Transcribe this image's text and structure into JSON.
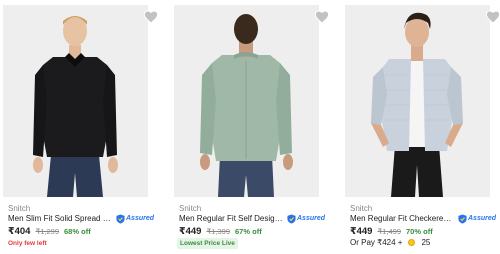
{
  "colors": {
    "image_bg": "#eeeeee",
    "offer_green": "#388e3c",
    "alert_red": "#e53935",
    "assured_blue": "#2874f0",
    "heart_grey": "#c2c2c2"
  },
  "products": [
    {
      "brand": "Snitch",
      "title": "Men Slim Fit Solid Spread Collar ...",
      "assured_label": "Assured",
      "price": "₹404",
      "mrp": "₹1,299",
      "discount": "68% off",
      "note": "Only few left",
      "shirt_color": "#1b1b1d",
      "pants_color": "#2c3a55",
      "icon": "heart-icon"
    },
    {
      "brand": "Snitch",
      "title": "Men Regular Fit Self Design Spr...",
      "assured_label": "Assured",
      "price": "₹449",
      "mrp": "₹1,399",
      "discount": "67% off",
      "badge": "Lowest Price Live",
      "shirt_color": "#9fb8a8",
      "pants_color": "#3b4a66",
      "icon": "heart-icon"
    },
    {
      "brand": "Snitch",
      "title": "Men Regular Fit Checkered Butt...",
      "assured_label": "Assured",
      "price": "₹449",
      "mrp": "₹1,499",
      "discount": "70% off",
      "or_pay": "Or Pay ₹424 +",
      "coins": "25",
      "shirt_color": "#c9d2dc",
      "pants_color": "#1a1a1a",
      "icon": "heart-icon"
    }
  ]
}
